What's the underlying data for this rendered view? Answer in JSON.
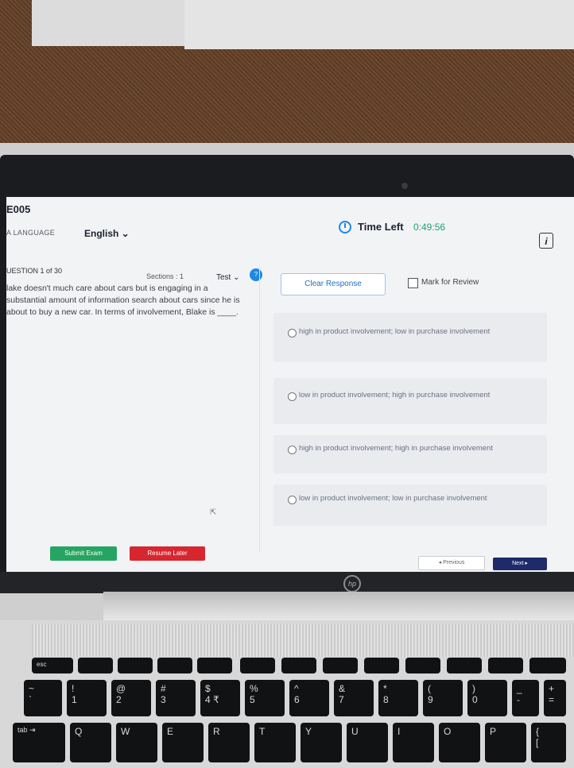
{
  "exam": {
    "code": "E005",
    "language_label": "A LANGUAGE",
    "language_value": "English ⌄"
  },
  "timer": {
    "label": "Time Left",
    "value": "0:49:56",
    "icon": "stopwatch-icon"
  },
  "question": {
    "number_label": "UESTION 1 of 30",
    "sections_label": "Sections : 1",
    "test_tab": "Test ⌄",
    "badge": "?",
    "text": "lake doesn't much care about cars but is engaging in a substantial amount of information search about cars since he is about to buy a new car. In terms of involvement, Blake is ____."
  },
  "actions": {
    "clear_response": "Clear Response",
    "mark_for_review": "Mark for Review",
    "submit_exam": "Submit Exam",
    "resume_later": "Resume Later",
    "previous": "◂ Previous",
    "next": "Next ▸"
  },
  "options": [
    "high in product involvement; low in purchase involvement",
    "low in product involvement; high in purchase involvement",
    "high in product involvement; high in purchase involvement",
    "low in product involvement; low in purchase involvement"
  ],
  "laptop": {
    "brand": "hp"
  },
  "keyboard": {
    "row1": [
      "esc",
      "",
      "",
      "",
      "",
      "",
      "",
      "",
      "",
      "",
      "",
      "",
      "",
      ""
    ],
    "row2": [
      "~\n`",
      "!\n1",
      "@\n2",
      "#\n3",
      "$\n4 ₹",
      "%\n5",
      "^\n6",
      "&\n7",
      "*\n8",
      "(\n9",
      ")\n0",
      "_\n-",
      "+\n="
    ],
    "row3": [
      "tab ⇥",
      "Q",
      "W",
      "E",
      "R",
      "T",
      "Y",
      "U",
      "I",
      "O",
      "P",
      "{\n["
    ]
  },
  "colors": {
    "accent": "#1e88e5",
    "timer_green": "#21a27a",
    "submit_green": "#26a562",
    "resume_red": "#d8262f",
    "next_navy": "#1f2a6b"
  }
}
